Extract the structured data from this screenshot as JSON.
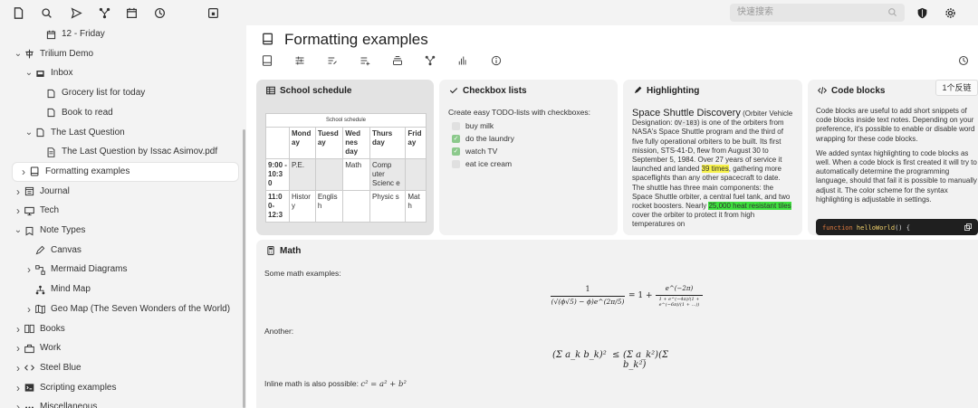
{
  "topbar": {
    "icons": [
      "new-note-icon",
      "search-icon",
      "send-icon",
      "network-icon",
      "calendar-icon",
      "history-icon",
      "calendar-add-icon"
    ],
    "search_placeholder": "快速搜索",
    "right_icons": [
      "shield-icon",
      "gear-icon"
    ]
  },
  "sidebar": {
    "items": [
      {
        "label": "12 - Friday",
        "icon": "calendar-icon",
        "indent": 2,
        "chevron": ""
      },
      {
        "label": "Trilium Demo",
        "icon": "trilium-icon",
        "indent": 0,
        "chevron": "v"
      },
      {
        "label": "Inbox",
        "icon": "inbox-icon",
        "indent": 1,
        "chevron": "v"
      },
      {
        "label": "Grocery list for today",
        "icon": "note-icon",
        "indent": 2,
        "chevron": ""
      },
      {
        "label": "Book to read",
        "icon": "note-icon",
        "indent": 2,
        "chevron": ""
      },
      {
        "label": "The Last Question",
        "icon": "note-icon",
        "indent": 1,
        "chevron": "v"
      },
      {
        "label": "The Last Question by Issac Asimov.pdf",
        "icon": "pdf-icon",
        "indent": 2,
        "chevron": ""
      },
      {
        "label": "Formatting examples",
        "icon": "book-icon",
        "indent": 0,
        "chevron": ">",
        "active": true
      },
      {
        "label": "Journal",
        "icon": "journal-icon",
        "indent": 0,
        "chevron": ">"
      },
      {
        "label": "Tech",
        "icon": "monitor-icon",
        "indent": 0,
        "chevron": ">"
      },
      {
        "label": "Note Types",
        "icon": "note-types-icon",
        "indent": 0,
        "chevron": "v"
      },
      {
        "label": "Canvas",
        "icon": "pen-icon",
        "indent": 1,
        "chevron": ""
      },
      {
        "label": "Mermaid Diagrams",
        "icon": "diagram-icon",
        "indent": 1,
        "chevron": ">"
      },
      {
        "label": "Mind Map",
        "icon": "mindmap-icon",
        "indent": 1,
        "chevron": ""
      },
      {
        "label": "Geo Map (The Seven Wonders of the World)",
        "icon": "map-icon",
        "indent": 1,
        "chevron": ">"
      },
      {
        "label": "Books",
        "icon": "books-icon",
        "indent": 0,
        "chevron": ">"
      },
      {
        "label": "Work",
        "icon": "work-icon",
        "indent": 0,
        "chevron": ">"
      },
      {
        "label": "Steel Blue",
        "icon": "code-icon",
        "indent": 0,
        "chevron": ">"
      },
      {
        "label": "Scripting examples",
        "icon": "script-icon",
        "indent": 0,
        "chevron": ">"
      },
      {
        "label": "Miscellaneous",
        "icon": "misc-icon",
        "indent": 0,
        "chevron": ">"
      }
    ]
  },
  "note": {
    "title": "Formatting examples",
    "ribbon_icons": [
      "note-info-icon",
      "properties-icon",
      "edit-icon",
      "promoted-icon",
      "owned-icon",
      "link-map-icon",
      "stats-icon",
      "info-icon"
    ],
    "history_icon": "history-icon"
  },
  "cards": {
    "schedule": {
      "title": "School schedule",
      "caption": "School schedule",
      "headers": [
        "",
        "Monday",
        "Tuesday",
        "Wednesday",
        "Thursday",
        "Friday"
      ],
      "header_display": [
        "",
        "Mond ay",
        "Tuesd ay",
        "Wed nes day",
        "Thurs day",
        "Frid ay"
      ],
      "rows": [
        [
          "9:00 - 10:30",
          "P.E.",
          "",
          "Math",
          "Computer Science",
          ""
        ],
        [
          "11:00- 12:3",
          "History",
          "English",
          "",
          "Physics",
          "Math"
        ]
      ],
      "rows_display": [
        [
          "9:00 - 10:3 0",
          "P.E.",
          "",
          "Math",
          "Comp uter Scienc e",
          ""
        ],
        [
          "11:0 0- 12:3",
          "Histor y",
          "Englis h",
          "",
          "Physic s",
          "Mat h"
        ]
      ]
    },
    "checkbox": {
      "title": "Checkbox lists",
      "intro": "Create easy TODO-lists with checkboxes:",
      "items": [
        {
          "label": "buy milk",
          "checked": false
        },
        {
          "label": "do the laundry",
          "checked": true
        },
        {
          "label": "watch TV",
          "checked": true
        },
        {
          "label": "eat ice cream",
          "checked": false
        }
      ]
    },
    "highlighting": {
      "title": "Highlighting",
      "heading": "Space Shuttle Discovery",
      "text_a": " (Orbiter Vehicle Designation: ",
      "code": "OV-103",
      "text_b": ") is one of the orbiters from NASA's Space Shuttle program and the third of five fully operational orbiters to be built. Its first mission, STS-41-D, flew from August 30 to September 5, 1984. Over 27 years of service it launched and landed ",
      "mark_yellow": "39 times",
      "text_c": ", gathering more spaceflights than any other spacecraft to date. The shuttle has three main components: the Space Shuttle orbiter, a central fuel tank, and two rocket boosters. Nearly ",
      "mark_green": "25,000 heat resistant tiles",
      "text_d": " cover the orbiter to protect it from high temperatures on"
    },
    "code": {
      "title": "Code blocks",
      "p1": "Code blocks are useful to add short snippets of code blocks inside text notes. Depending on your preference, it's possible to enable or disable word wrapping for these code blocks.",
      "p2": "We added syntax highlighting to code blocks as well. When a code block is first created it will try to automatically determine the programming language, should that fail it is possible to manually adjust it. The color scheme for the syntax highlighting is adjustable in settings.",
      "snippet_kw": "function",
      "snippet_fn": " helloWorld",
      "snippet_rest": "() {",
      "tooltip": "1个反链"
    },
    "math": {
      "title": "Math",
      "intro": "Some math examples:",
      "another": "Another:",
      "inline_label": "Inline math is also possible: ",
      "inline_formula": "c² = a² + b²",
      "formula1_lhs_num": "1",
      "formula1_lhs_den": "(√(ϕ√5) − ϕ)e^(2π/5)",
      "formula1_rhs": "= 1 +",
      "formula1_rhs_num": "e^(−2π)",
      "formula1_rhs_den": "1 + e^(−4π)/(1 + e^(−6π)/(1 + …))",
      "formula2_lhs": "(Σ a_k b_k)²",
      "formula2_op": "≤",
      "formula2_rhs": "(Σ a_k²)(Σ b_k²)"
    }
  }
}
